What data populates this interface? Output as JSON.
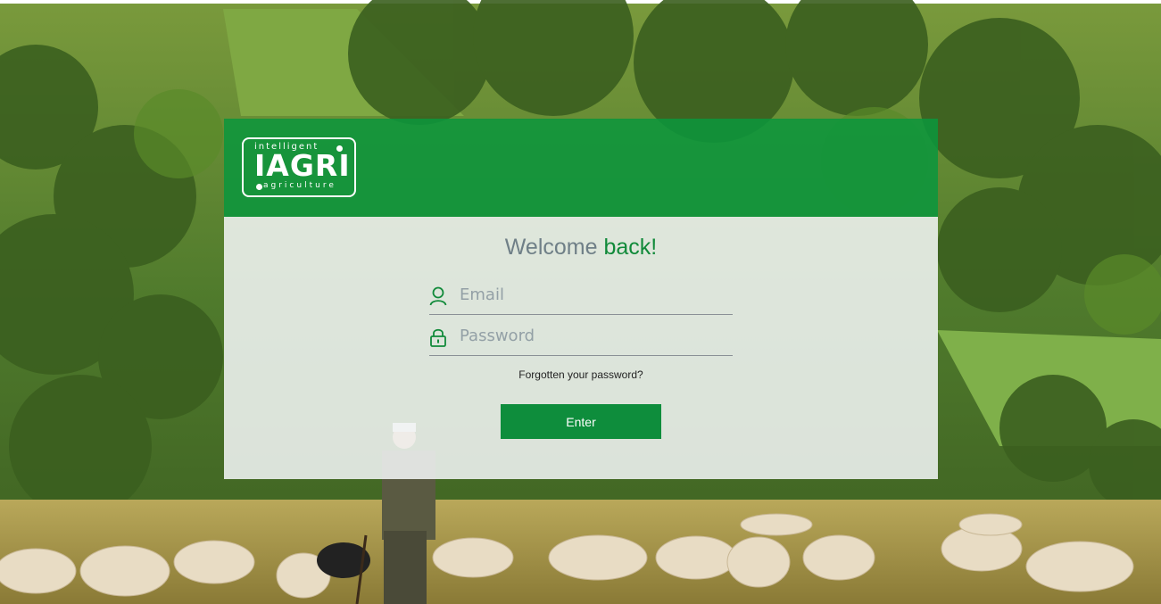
{
  "logo": {
    "top": "intelligent",
    "main": "IAGRI",
    "bottom": "agriculture"
  },
  "welcome": {
    "prefix": "Welcome ",
    "accent": "back!"
  },
  "form": {
    "email_placeholder": "Email",
    "password_placeholder": "Password",
    "forgot_label": "Forgotten your password?",
    "enter_label": "Enter"
  },
  "colors": {
    "brand_green": "#0e8d3c",
    "welcome_gray": "#6f7f87"
  },
  "icons": {
    "email": "user-icon",
    "password": "lock-icon"
  }
}
